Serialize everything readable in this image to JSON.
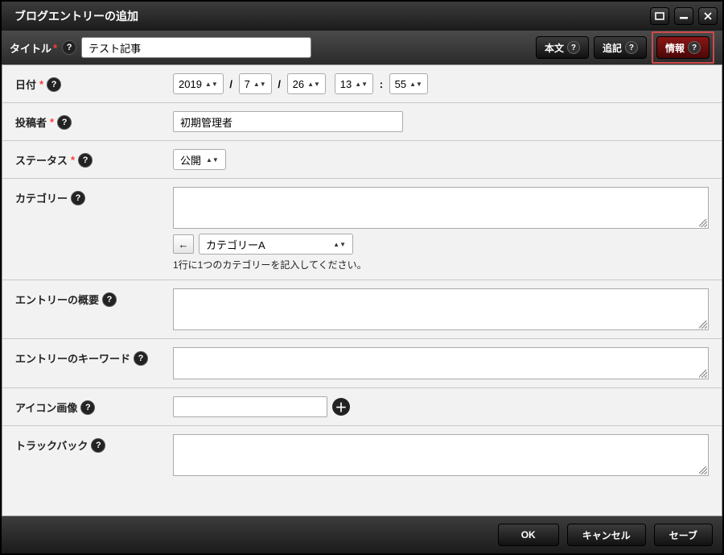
{
  "window": {
    "title": "ブログエントリーの追加"
  },
  "toolbar": {
    "title_label": "タイトル",
    "title_value": "テスト記事",
    "tabs": {
      "body": "本文",
      "note": "追記",
      "info": "情報"
    }
  },
  "fields": {
    "date": {
      "label": "日付",
      "year": "2019",
      "month": "7",
      "day": "26",
      "hour": "13",
      "minute": "55"
    },
    "author": {
      "label": "投稿者",
      "value": "初期管理者"
    },
    "status": {
      "label": "ステータス",
      "value": "公開"
    },
    "category": {
      "label": "カテゴリー",
      "value": "",
      "selector": "カテゴリーA",
      "hint": "1行に1つのカテゴリーを記入してください。",
      "arrow_btn": "←"
    },
    "summary": {
      "label": "エントリーの概要",
      "value": ""
    },
    "keyword": {
      "label": "エントリーのキーワード",
      "value": ""
    },
    "icon": {
      "label": "アイコン画像",
      "value": ""
    },
    "trackback": {
      "label": "トラックバック",
      "value": ""
    }
  },
  "footer": {
    "ok": "OK",
    "cancel": "キャンセル",
    "save": "セーブ"
  }
}
